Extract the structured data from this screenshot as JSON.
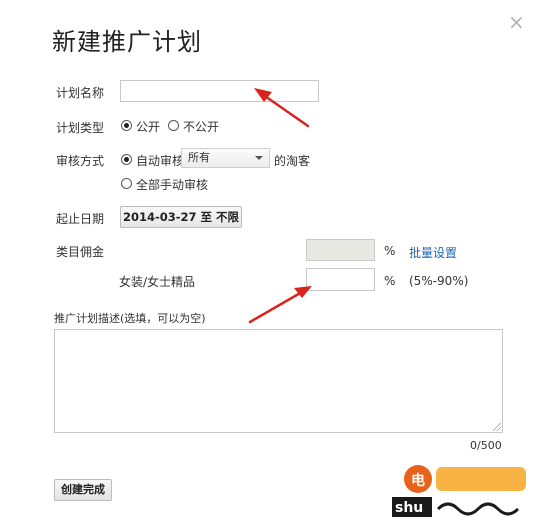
{
  "dialog": {
    "title": "新建推广计划",
    "close_symbol": "×"
  },
  "form": {
    "plan_name": {
      "label": "计划名称",
      "value": ""
    },
    "plan_type": {
      "label": "计划类型",
      "options": [
        "公开",
        "不公开"
      ],
      "selected": "公开"
    },
    "review": {
      "label": "审核方式",
      "auto_label": "自动审核",
      "select_value": "所有",
      "suffix": "的淘客",
      "manual_label": "全部手动审核",
      "selected": "自动审核"
    },
    "date_range": {
      "label": "起止日期",
      "value": "2014-03-27 至 不限"
    },
    "commission": {
      "label": "类目佣金",
      "percent_symbol": "%",
      "batch_link": "批量设置",
      "category_label": "女装/女士精品",
      "category_value": "",
      "range_hint": "(5%-90%)"
    },
    "description": {
      "label": "推广计划描述(选填，可以为空)",
      "value": "",
      "counter": "0/500"
    },
    "submit_label": "创建完成"
  },
  "watermark": {
    "text": "shu",
    "colors": {
      "badge": "#e8621c",
      "dark": "#1a1a1a"
    }
  },
  "annotation_color": "#d9241b"
}
